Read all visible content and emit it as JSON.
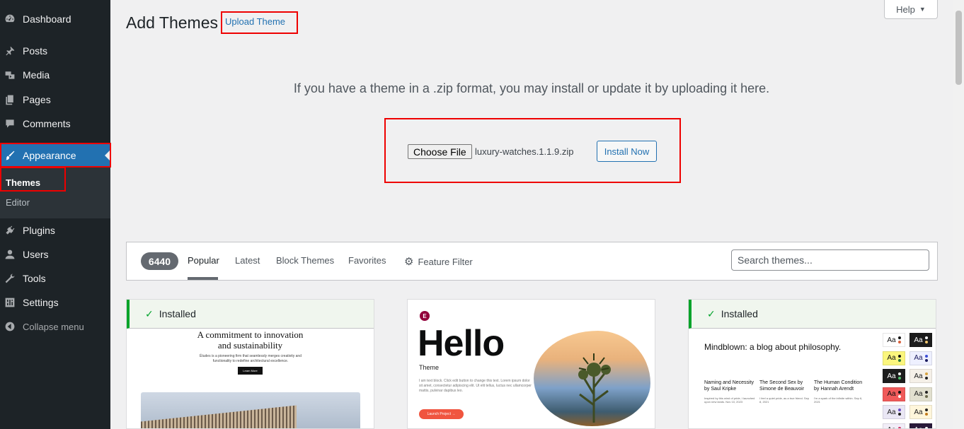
{
  "sidebar": {
    "items": [
      {
        "label": "Dashboard",
        "icon": "dashboard-icon"
      },
      {
        "label": "Posts",
        "icon": "pin-icon"
      },
      {
        "label": "Media",
        "icon": "media-icon"
      },
      {
        "label": "Pages",
        "icon": "pages-icon"
      },
      {
        "label": "Comments",
        "icon": "comment-icon"
      },
      {
        "label": "Appearance",
        "icon": "brush-icon"
      },
      {
        "label": "Plugins",
        "icon": "plug-icon"
      },
      {
        "label": "Users",
        "icon": "user-icon"
      },
      {
        "label": "Tools",
        "icon": "wrench-icon"
      },
      {
        "label": "Settings",
        "icon": "settings-icon"
      },
      {
        "label": "Collapse menu",
        "icon": "collapse-icon"
      }
    ],
    "submenu": [
      {
        "label": "Themes"
      },
      {
        "label": "Editor"
      }
    ]
  },
  "header": {
    "title": "Add Themes",
    "upload_label": "Upload Theme",
    "help_label": "Help"
  },
  "upload": {
    "description": "If you have a theme in a .zip format, you may install or update it by uploading it here.",
    "choose_label": "Choose File",
    "file_name": "luxury-watches.1.1.9.zip",
    "install_label": "Install Now"
  },
  "filter": {
    "count": "6440",
    "tabs": [
      "Popular",
      "Latest",
      "Block Themes",
      "Favorites"
    ],
    "feature_filter": "Feature Filter",
    "search_placeholder": "Search themes..."
  },
  "cards": [
    {
      "installed": "Installed",
      "heading_line1": "A commitment to innovation",
      "heading_line2": "and sustainability",
      "sub": "Études is a pioneering firm that seamlessly merges creativity and functionality to redefine architectural excellence.",
      "button": "Learn More"
    },
    {
      "logo": "E",
      "hello": "Hello",
      "theme": "Theme",
      "body": "I am text block. Click edit button to change this text. Lorem ipsum dolor sit amet, consectetur adipiscing elit. Ut elit tellus, luctus nec ullamcorper mattis, pulvinar dapibus leo.",
      "button": "Launch Project →"
    },
    {
      "installed": "Installed",
      "title": "Mindblown: a blog about philosophy.",
      "columns": [
        {
          "title": "Naming and Necessity by Saul Kripke",
          "meta": "Inspired by this wind of pride, I launched upon new lands. Nov 10, 2023"
        },
        {
          "title": "The Second Sex by Simone de Beauvoir",
          "meta": "I feel a quiet pride, as a true friend. Sep 8, 2021"
        },
        {
          "title": "The Human Condition by Hannah Arendt",
          "meta": "I'm a spark of the infinite within. Sep 6, 2021"
        }
      ],
      "swatch_label": "Aa",
      "swatches": [
        {
          "bg": "#ffffff",
          "fg": "#111111",
          "d1": "#111111",
          "d2": "#d8613c"
        },
        {
          "bg": "#1c1c1c",
          "fg": "#ffffff",
          "d1": "#ffffff",
          "d2": "#f0c56b"
        },
        {
          "bg": "#fbf67d",
          "fg": "#111111",
          "d1": "#111111",
          "d2": "#2b7a3b"
        },
        {
          "bg": "#eef0ff",
          "fg": "#1a1a5e",
          "d1": "#3b4cd4",
          "d2": "#1a1a5e"
        },
        {
          "bg": "#1d1d1d",
          "fg": "#ffffff",
          "d1": "#ffffff",
          "d2": "#4fbf6a"
        },
        {
          "bg": "#f5f0e8",
          "fg": "#222222",
          "d1": "#d9a441",
          "d2": "#222222"
        },
        {
          "bg": "#f05a5a",
          "fg": "#111111",
          "d1": "#111111",
          "d2": "#ffffff"
        },
        {
          "bg": "#e2e0cf",
          "fg": "#222222",
          "d1": "#222222",
          "d2": "#6b6a4b"
        },
        {
          "bg": "#eae7f5",
          "fg": "#222222",
          "d1": "#6a4fc2",
          "d2": "#222222"
        },
        {
          "bg": "#fff6db",
          "fg": "#222222",
          "d1": "#222222",
          "d2": "#c27a1a"
        },
        {
          "bg": "#f2eef8",
          "fg": "#222222",
          "d1": "#cc3366",
          "d2": "#222222"
        },
        {
          "bg": "#2a1a3a",
          "fg": "#ffffff",
          "d1": "#ffffff",
          "d2": "#e8b34a"
        }
      ]
    }
  ],
  "colors": {
    "sidebar_bg": "#1d2327",
    "active_bg": "#2271b1",
    "highlight_box": "#ee0000",
    "installed_green": "#00a32a"
  }
}
